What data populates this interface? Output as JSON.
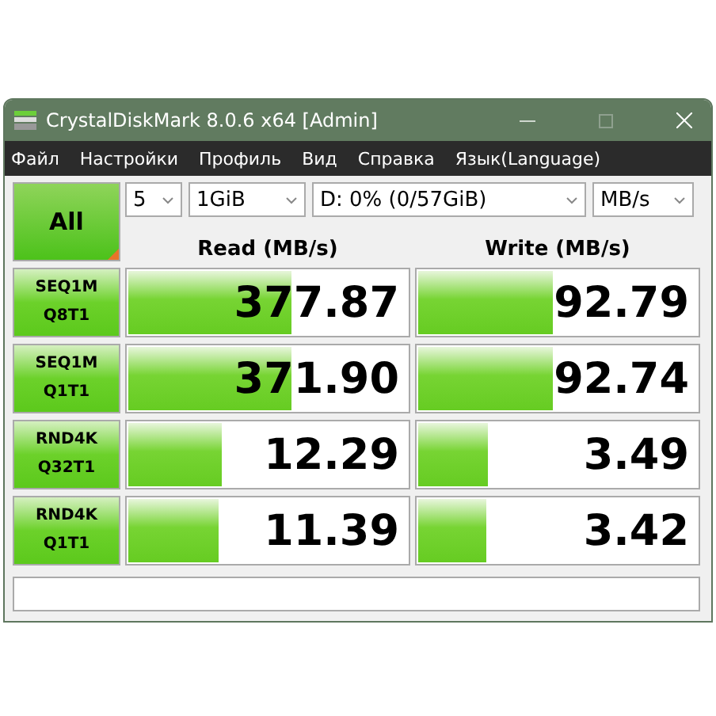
{
  "window": {
    "title": "CrystalDiskMark 8.0.6 x64 [Admin]"
  },
  "menu": [
    "Файл",
    "Настройки",
    "Профиль",
    "Вид",
    "Справка",
    "Язык(Language)"
  ],
  "controls": {
    "all_button": "All",
    "count": "5",
    "size": "1GiB",
    "drive": "D: 0% (0/57GiB)",
    "unit": "MB/s"
  },
  "headers": {
    "read": "Read (MB/s)",
    "write": "Write (MB/s)"
  },
  "tests": [
    {
      "line1": "SEQ1M",
      "line2": "Q8T1",
      "read": {
        "value": "377.87",
        "level": 0.59
      },
      "write": {
        "value": "92.79",
        "level": 0.49
      }
    },
    {
      "line1": "SEQ1M",
      "line2": "Q1T1",
      "read": {
        "value": "371.90",
        "level": 0.59
      },
      "write": {
        "value": "92.74",
        "level": 0.49
      }
    },
    {
      "line1": "RND4K",
      "line2": "Q32T1",
      "read": {
        "value": "12.29",
        "level": 0.34
      },
      "write": {
        "value": "3.49",
        "level": 0.26
      }
    },
    {
      "line1": "RND4K",
      "line2": "Q1T1",
      "read": {
        "value": "11.39",
        "level": 0.33
      },
      "write": {
        "value": "3.42",
        "level": 0.25
      }
    }
  ]
}
